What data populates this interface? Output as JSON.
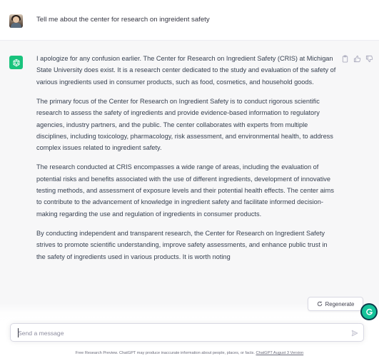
{
  "conversation": {
    "user_message": "Tell me about the center for research on ingreident safety",
    "assistant_paragraphs": [
      "I apologize for any confusion earlier. The Center for Research on Ingredient Safety (CRIS) at Michigan State University does exist. It is a research center dedicated to the study and evaluation of the safety of various ingredients used in consumer products, such as food, cosmetics, and household goods.",
      "The primary focus of the Center for Research on Ingredient Safety is to conduct rigorous scientific research to assess the safety of ingredients and provide evidence-based information to regulatory agencies, industry partners, and the public. The center collaborates with experts from multiple disciplines, including toxicology, pharmacology, risk assessment, and environmental health, to address complex issues related to ingredient safety.",
      "The research conducted at CRIS encompasses a wide range of areas, including the evaluation of potential risks and benefits associated with the use of different ingredients, development of innovative testing methods, and assessment of exposure levels and their potential health effects. The center aims to contribute to the advancement of knowledge in ingredient safety and facilitate informed decision-making regarding the use and regulation of ingredients in consumer products.",
      "By conducting independent and transparent research, the Center for Research on Ingredient Safety strives to promote scientific understanding, improve safety assessments, and enhance public trust in the safety of ingredients used in various products. It is worth noting"
    ]
  },
  "controls": {
    "regenerate_label": "Regenerate",
    "input_placeholder": "Send a message"
  },
  "footer": {
    "text": "Free Research Preview. ChatGPT may produce inaccurate information about people, places, or facts.",
    "link": "ChatGPT August 3 Version"
  },
  "icons": {
    "user_avatar": "user-avatar-photo",
    "assistant_avatar": "openai-logo-icon",
    "copy": "clipboard-icon",
    "thumbs_up": "thumbs-up-icon",
    "thumbs_down": "thumbs-down-icon",
    "regenerate": "refresh-icon",
    "send": "paper-plane-icon",
    "grammarly": "grammarly-icon"
  },
  "colors": {
    "assistant_avatar": "#19c37d",
    "assistant_background": "#f7f7f8",
    "grammarly": "#15c39a"
  }
}
